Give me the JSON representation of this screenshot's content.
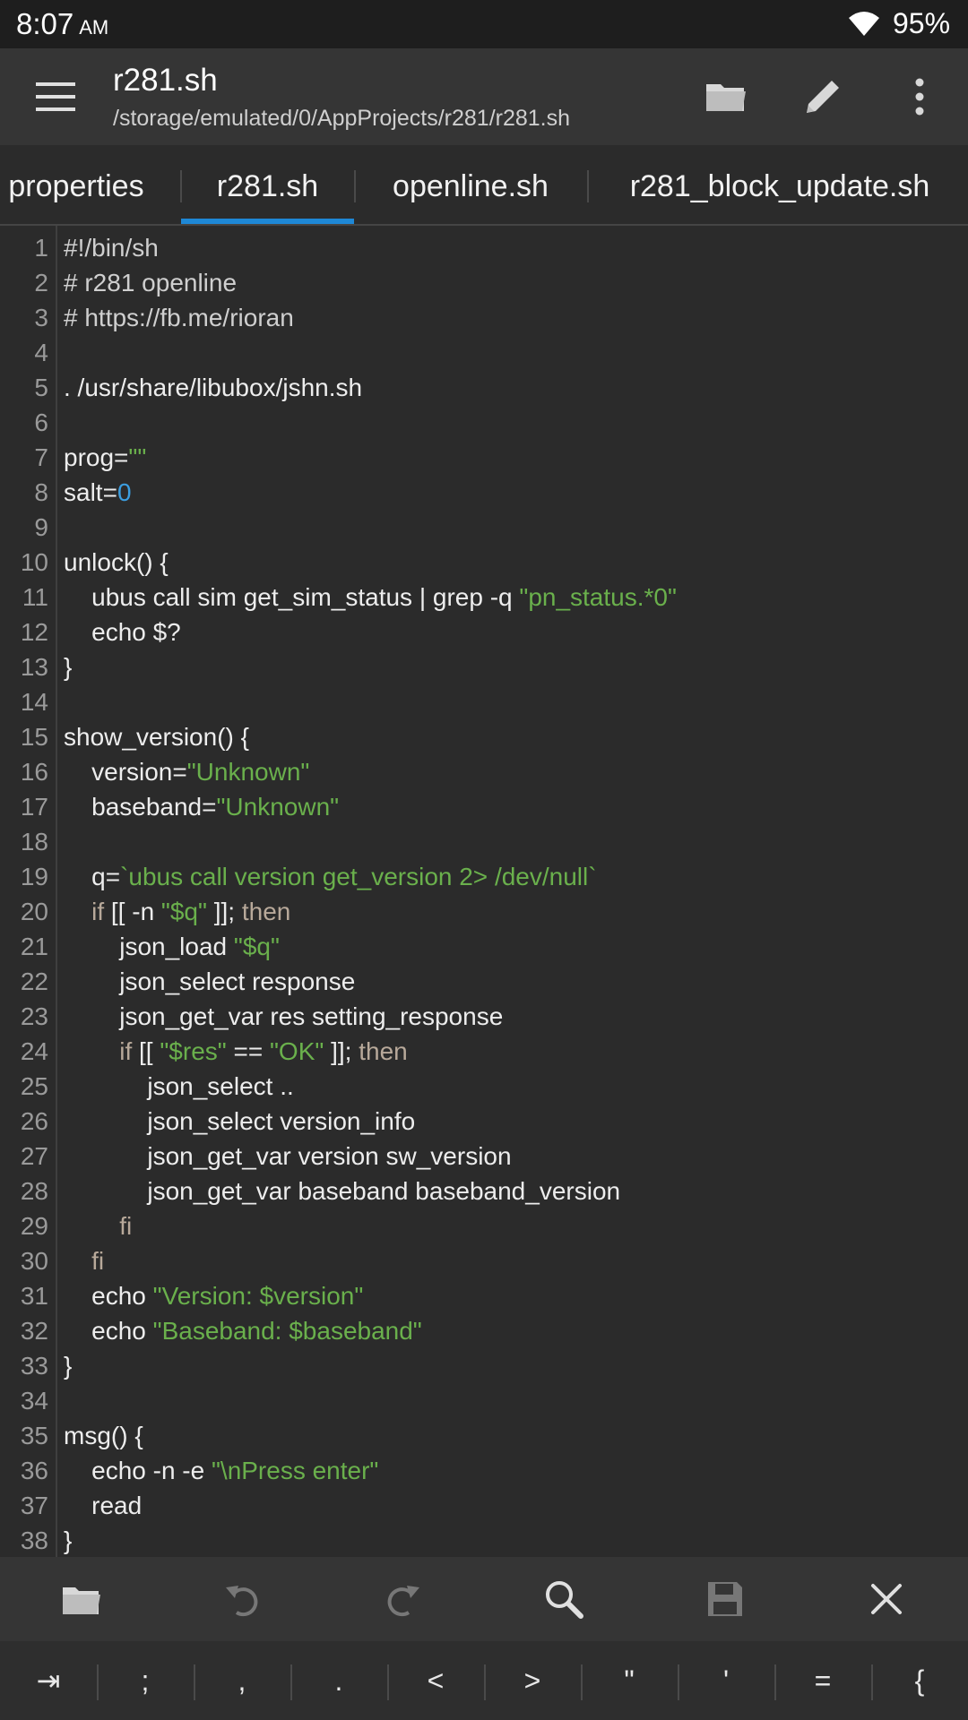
{
  "status_bar": {
    "time": "8:07",
    "ampm": "AM",
    "battery": "95%",
    "wifi_icon": "wifi-icon"
  },
  "app_bar": {
    "title": "r281.sh",
    "subtitle": "/storage/emulated/0/AppProjects/r281/r281.sh",
    "icons": [
      "menu-icon",
      "folder-icon",
      "pencil-icon",
      "more-vertical-icon"
    ]
  },
  "tabs": [
    {
      "label": "properties",
      "active": false
    },
    {
      "label": "r281.sh",
      "active": true
    },
    {
      "label": "openline.sh",
      "active": false
    },
    {
      "label": "r281_block_update.sh",
      "active": false
    }
  ],
  "editor": {
    "lines": [
      {
        "n": "1",
        "code": "#!/bin/sh"
      },
      {
        "n": "2",
        "code": "# r281 openline"
      },
      {
        "n": "3",
        "code": "# https://fb.me/rioran"
      },
      {
        "n": "4",
        "code": ""
      },
      {
        "n": "5",
        "code": ". /usr/share/libubox/jshn.sh"
      },
      {
        "n": "6",
        "code": ""
      },
      {
        "n": "7",
        "code": "prog=\"\""
      },
      {
        "n": "8",
        "code": "salt=0"
      },
      {
        "n": "9",
        "code": ""
      },
      {
        "n": "10",
        "code": "unlock() {"
      },
      {
        "n": "11",
        "code": "    ubus call sim get_sim_status | grep -q \"pn_status.*0\""
      },
      {
        "n": "12",
        "code": "    echo $?"
      },
      {
        "n": "13",
        "code": "}"
      },
      {
        "n": "14",
        "code": ""
      },
      {
        "n": "15",
        "code": "show_version() {"
      },
      {
        "n": "16",
        "code": "    version=\"Unknown\""
      },
      {
        "n": "17",
        "code": "    baseband=\"Unknown\""
      },
      {
        "n": "18",
        "code": ""
      },
      {
        "n": "19",
        "code": "    q=`ubus call version get_version 2> /dev/null`"
      },
      {
        "n": "20",
        "code": "    if [[ -n \"$q\" ]]; then"
      },
      {
        "n": "21",
        "code": "        json_load \"$q\""
      },
      {
        "n": "22",
        "code": "        json_select response"
      },
      {
        "n": "23",
        "code": "        json_get_var res setting_response"
      },
      {
        "n": "24",
        "code": "        if [[ \"$res\" == \"OK\" ]]; then"
      },
      {
        "n": "25",
        "code": "            json_select .."
      },
      {
        "n": "26",
        "code": "            json_select version_info"
      },
      {
        "n": "27",
        "code": "            json_get_var version sw_version"
      },
      {
        "n": "28",
        "code": "            json_get_var baseband baseband_version"
      },
      {
        "n": "29",
        "code": "        fi"
      },
      {
        "n": "30",
        "code": "    fi"
      },
      {
        "n": "31",
        "code": "    echo \"Version: $version\""
      },
      {
        "n": "32",
        "code": "    echo \"Baseband: $baseband\""
      },
      {
        "n": "33",
        "code": "}"
      },
      {
        "n": "34",
        "code": ""
      },
      {
        "n": "35",
        "code": "msg() {"
      },
      {
        "n": "36",
        "code": "    echo -n -e \"\\nPress enter\""
      },
      {
        "n": "37",
        "code": "    read"
      },
      {
        "n": "38",
        "code": "}"
      }
    ]
  },
  "bottom_toolbar": {
    "icons": [
      "open-folder-icon",
      "undo-icon",
      "redo-icon",
      "search-icon",
      "save-icon",
      "close-icon"
    ]
  },
  "symbol_bar": {
    "keys": [
      "⇥",
      ";",
      ",",
      ".",
      "<",
      ">",
      "\"",
      "'",
      "=",
      "{"
    ]
  },
  "colors": {
    "background": "#2b2b2b",
    "appbar": "#353535",
    "accent": "#1e88d6",
    "string": "#6ab04c",
    "number": "#3c9ee0",
    "keyword": "#b8a99a"
  }
}
